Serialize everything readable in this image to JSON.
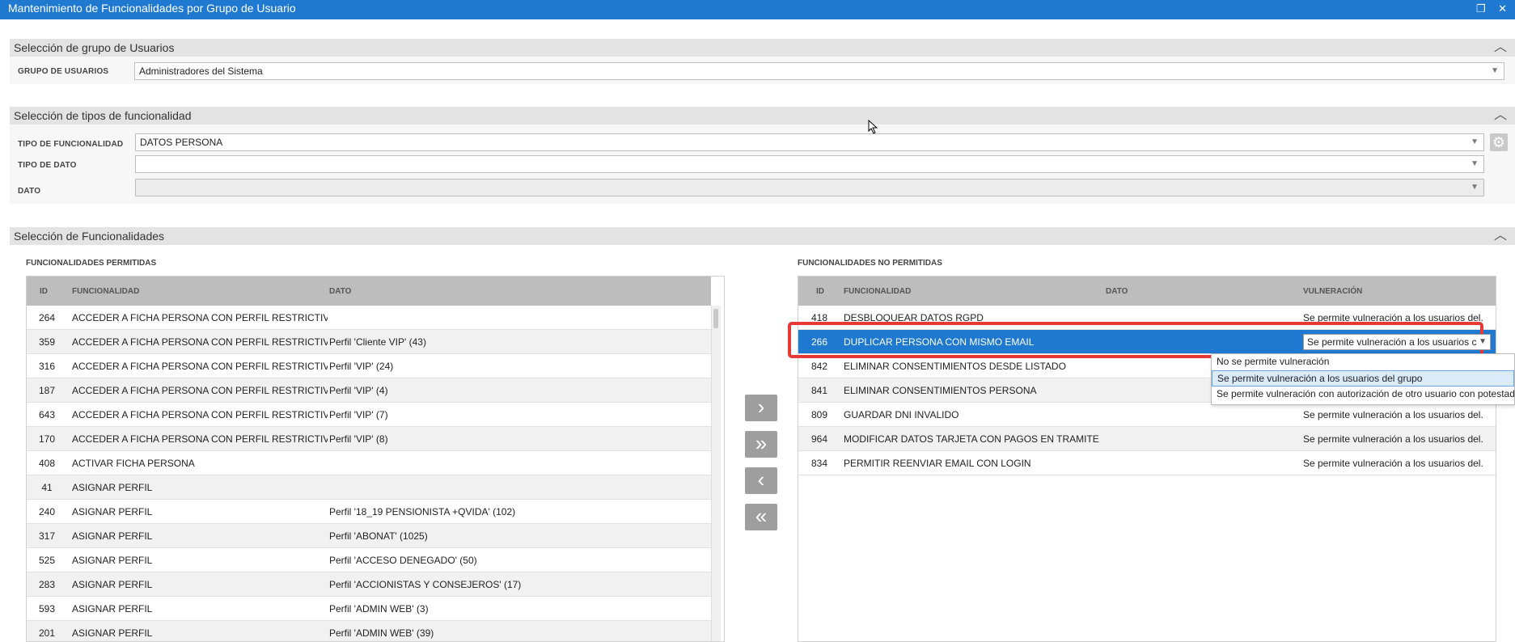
{
  "window": {
    "title": "Mantenimiento de Funcionalidades por Grupo de Usuario",
    "buttons": "❐ ✕"
  },
  "user_group_section": {
    "title": "Selección de grupo de Usuarios",
    "group_label": "GRUPO DE USUARIOS",
    "group_value": "Administradores del Sistema"
  },
  "type_section": {
    "title": "Selección de tipos de funcionalidad",
    "tipo_funcionalidad_label": "TIPO DE FUNCIONALIDAD",
    "tipo_funcionalidad_value": "DATOS PERSONA",
    "tipo_dato_label": "TIPO DE DATO",
    "tipo_dato_value": "",
    "dato_label": "DATO",
    "dato_value": ""
  },
  "functionality_section": {
    "title": "Selección de Funcionalidades",
    "allowed": {
      "title": "FUNCIONALIDADES PERMITIDAS",
      "columns": [
        "ID",
        "FUNCIONALIDAD",
        "DATO"
      ],
      "rows": [
        [
          "264",
          "ACCEDER A FICHA PERSONA CON PERFIL RESTRICTIVO",
          ""
        ],
        [
          "359",
          "ACCEDER A FICHA PERSONA CON PERFIL RESTRICTIVO",
          "Perfil 'Cliente VIP' (43)"
        ],
        [
          "316",
          "ACCEDER A FICHA PERSONA CON PERFIL RESTRICTIVO",
          "Perfil 'VIP' (24)"
        ],
        [
          "187",
          "ACCEDER A FICHA PERSONA CON PERFIL RESTRICTIVO",
          "Perfil 'VIP' (4)"
        ],
        [
          "643",
          "ACCEDER A FICHA PERSONA CON PERFIL RESTRICTIVO",
          "Perfil 'VIP' (7)"
        ],
        [
          "170",
          "ACCEDER A FICHA PERSONA CON PERFIL RESTRICTIVO",
          "Perfil 'VIP' (8)"
        ],
        [
          "408",
          "ACTIVAR FICHA PERSONA",
          ""
        ],
        [
          "41",
          "ASIGNAR PERFIL",
          ""
        ],
        [
          "240",
          "ASIGNAR PERFIL",
          "Perfil '18_19 PENSIONISTA +QVIDA' (102)"
        ],
        [
          "317",
          "ASIGNAR PERFIL",
          "Perfil 'ABONAT' (1025)"
        ],
        [
          "525",
          "ASIGNAR PERFIL",
          "Perfil 'ACCESO DENEGADO' (50)"
        ],
        [
          "283",
          "ASIGNAR PERFIL",
          "Perfil 'ACCIONISTAS Y CONSEJEROS' (17)"
        ],
        [
          "593",
          "ASIGNAR PERFIL",
          "Perfil 'ADMIN WEB' (3)"
        ],
        [
          "201",
          "ASIGNAR PERFIL",
          "Perfil 'ADMIN WEB' (39)"
        ]
      ]
    },
    "move_buttons": {
      "move_right": "›",
      "move_all_right": "»",
      "move_left": "‹",
      "move_all_left": "«"
    },
    "not_allowed": {
      "title": "FUNCIONALIDADES NO PERMITIDAS",
      "columns": [
        "ID",
        "FUNCIONALIDAD",
        "DATO",
        "VULNERACIÓN"
      ],
      "rows": [
        [
          "418",
          "DESBLOQUEAR DATOS RGPD",
          "",
          "Se permite vulneración a los usuarios del..."
        ],
        [
          "266",
          "DUPLICAR PERSONA CON MISMO EMAIL",
          "",
          "Se permite vulneración a los usuarios c"
        ],
        [
          "842",
          "ELIMINAR CONSENTIMIENTOS DESDE LISTADO",
          "",
          ""
        ],
        [
          "841",
          "ELIMINAR CONSENTIMIENTOS PERSONA",
          "",
          ""
        ],
        [
          "809",
          "GUARDAR DNI INVALIDO",
          "",
          "Se permite vulneración a los usuarios del..."
        ],
        [
          "964",
          "MODIFICAR DATOS TARJETA CON PAGOS EN TRAMITE DE CC",
          "",
          "Se permite vulneración a los usuarios del..."
        ],
        [
          "834",
          "PERMITIR REENVIAR EMAIL CON LOGIN",
          "",
          "Se permite vulneración a los usuarios del..."
        ]
      ],
      "selected_row": 1
    },
    "vulneration_dropdown": {
      "options": [
        "No se permite vulneración",
        "Se permite vulneración a los usuarios del grupo",
        "Se permite vulneración con autorización de otro usuario con potestad"
      ],
      "active_index": 1
    }
  },
  "colors": {
    "accent": "#1f79d0",
    "highlight": "#e53935",
    "header_gray": "#bdbdbd"
  }
}
